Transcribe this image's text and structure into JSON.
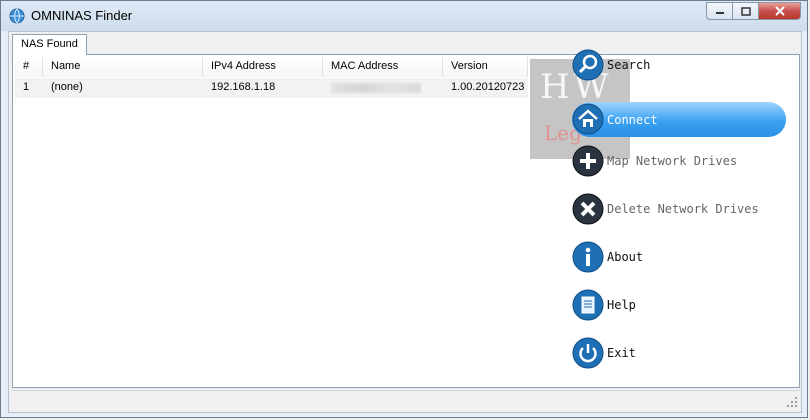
{
  "window": {
    "title": "OMNINAS Finder"
  },
  "tab": {
    "label": "NAS Found"
  },
  "table": {
    "columns": [
      "#",
      "Name",
      "IPv4 Address",
      "MAC Address",
      "Version"
    ],
    "rows": [
      {
        "num": "1",
        "name": "(none)",
        "ip": "192.168.1.18",
        "mac": "",
        "version": "1.00.20120723"
      }
    ]
  },
  "watermark": {
    "main": "HW",
    "sub": "Leg"
  },
  "menu": {
    "search": "Search",
    "connect": "Connect",
    "map": "Map Network Drives",
    "delete": "Delete Network Drives",
    "about": "About",
    "help": "Help",
    "exit": "Exit"
  },
  "colors": {
    "accent": "#3aa2f2",
    "icon_dark": "#1e2c3a",
    "icon_blue": "#1f6fb5"
  }
}
